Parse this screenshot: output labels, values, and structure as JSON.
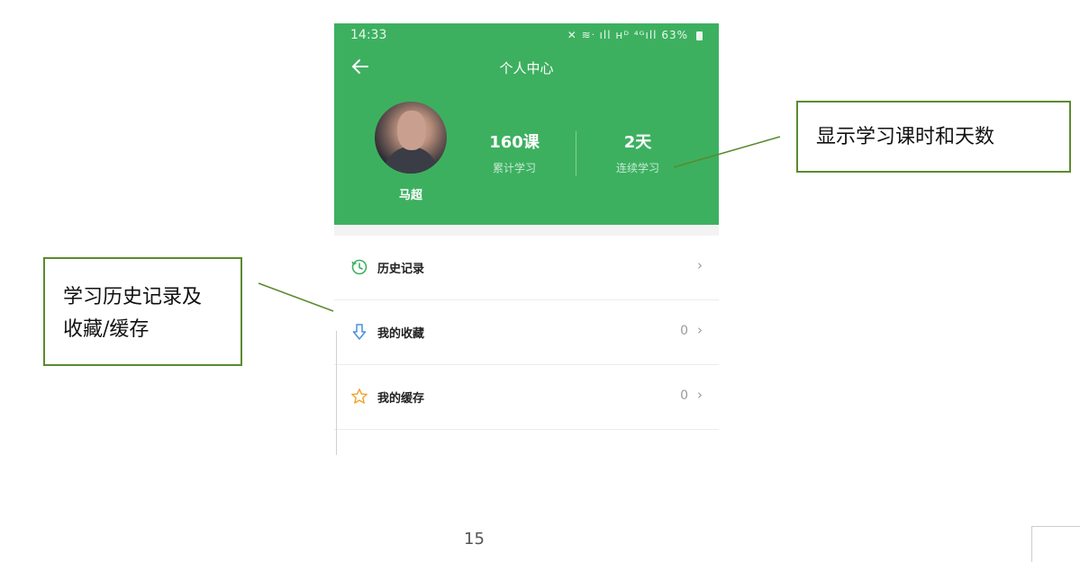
{
  "status_bar": {
    "time": "14:33",
    "icons_text": "✕ ≋ᐧ ıll ʜᴰ ⁴ᴳıll",
    "battery": "63%"
  },
  "header": {
    "title": "个人中心"
  },
  "profile": {
    "name": "马超"
  },
  "stats": [
    {
      "value": "160课",
      "label": "累计学习"
    },
    {
      "value": "2天",
      "label": "连续学习"
    }
  ],
  "menu": [
    {
      "label": "历史记录",
      "icon": "history-clock-icon",
      "count": ""
    },
    {
      "label": "我的收藏",
      "icon": "download-arrow-icon",
      "count": "0"
    },
    {
      "label": "我的缓存",
      "icon": "star-outline-icon",
      "count": "0"
    }
  ],
  "annotations": {
    "right": "显示学习课时和天数",
    "left_line1": "学习历史记录及",
    "left_line2": "收藏/缓存"
  },
  "page_number": "15",
  "colors": {
    "header_green": "#3db060",
    "callout_border": "#5b8a2e"
  }
}
